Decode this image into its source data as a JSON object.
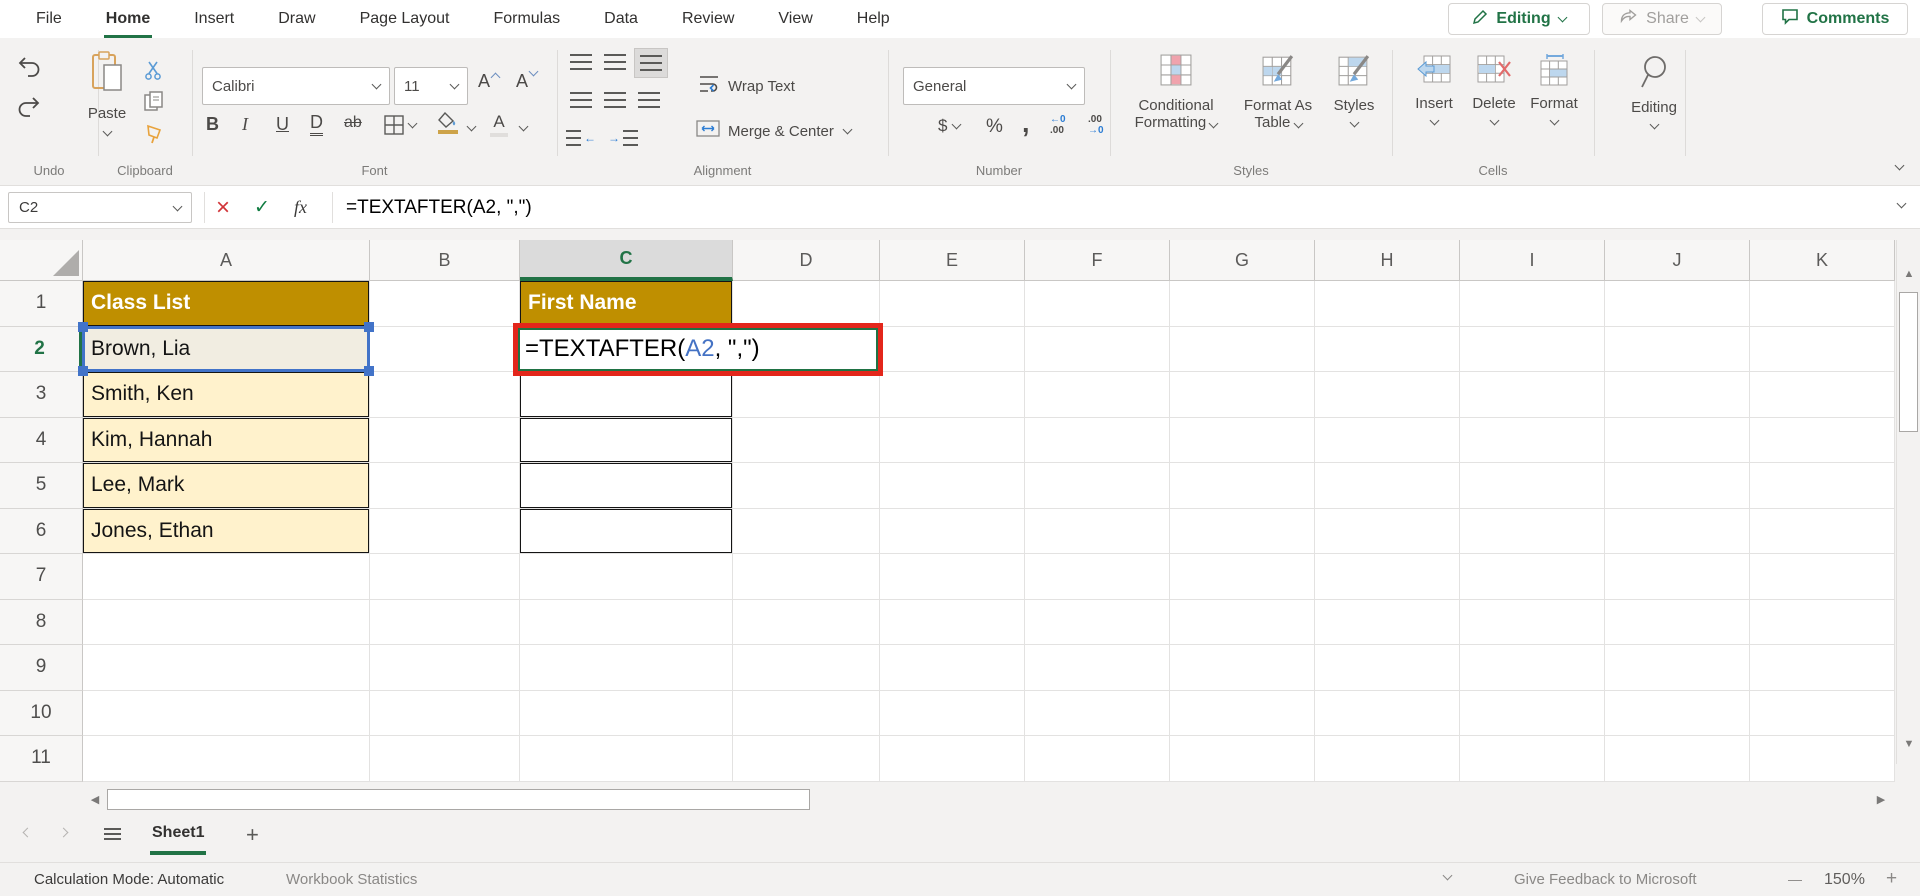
{
  "titlebar": {
    "tabs": [
      "File",
      "Home",
      "Insert",
      "Draw",
      "Page Layout",
      "Formulas",
      "Data",
      "Review",
      "View",
      "Help"
    ],
    "active_tab": "Home",
    "editing_button": "Editing",
    "share_button": "Share",
    "comments_button": "Comments"
  },
  "ribbon": {
    "paste": "Paste",
    "font_name": "Calibri",
    "font_size": "11",
    "bold": "B",
    "italic": "I",
    "underline": "U",
    "double_underline": "D",
    "strikethrough": "ab",
    "wrap_text": "Wrap Text",
    "merge_center": "Merge & Center",
    "number_format": "General",
    "currency": "$",
    "percent": "%",
    "comma": ",",
    "inc_dec_top": "←0",
    "inc_dec_bot": ".00",
    "dec_dec_top": ".00",
    "dec_dec_bot": "→0",
    "cond_fmt_line1": "Conditional",
    "cond_fmt_line2": "Formatting",
    "fmt_table_line1": "Format As",
    "fmt_table_line2": "Table",
    "styles": "Styles",
    "insert": "Insert",
    "delete": "Delete",
    "format": "Format",
    "editing": "Editing",
    "font_color_letter": "A",
    "grow_font_letter": "A",
    "shrink_font_letter": "A",
    "group_labels": [
      "Undo",
      "Clipboard",
      "Font",
      "Alignment",
      "Number",
      "Styles",
      "Cells"
    ]
  },
  "formula_bar": {
    "name_box": "C2",
    "fx": "fx",
    "formula": "=TEXTAFTER(A2, \",\")"
  },
  "grid": {
    "column_letters": [
      "A",
      "B",
      "C",
      "D",
      "E",
      "F",
      "G",
      "H",
      "I",
      "J",
      "K"
    ],
    "row_numbers": [
      "1",
      "2",
      "3",
      "4",
      "5",
      "6",
      "7",
      "8",
      "9",
      "10",
      "11"
    ],
    "selected_cell": "C2",
    "cells": {
      "a1": "Class List",
      "c1": "First Name",
      "names": [
        "Brown, Lia",
        "Smith, Ken",
        "Kim, Hannah",
        "Lee, Mark",
        "Jones, Ethan"
      ]
    },
    "c2_formula": {
      "pre": "=TEXTAFTER(",
      "ref": "A2",
      "post": ", \",\")"
    }
  },
  "sheet_bar": {
    "sheet_name": "Sheet1",
    "add_sheet": "+"
  },
  "status_bar": {
    "calc_mode": "Calculation Mode: Automatic",
    "workbook_stats": "Workbook Statistics",
    "feedback": "Give Feedback to Microsoft",
    "zoom_out": "—",
    "zoom_level": "150%",
    "zoom_in": "+"
  },
  "colors": {
    "excel_green": "#217346",
    "header_gold": "#BF8F00",
    "row_cream": "#FFF2CC",
    "selection_blue": "#4273C8",
    "highlight_red": "#E3261B"
  }
}
